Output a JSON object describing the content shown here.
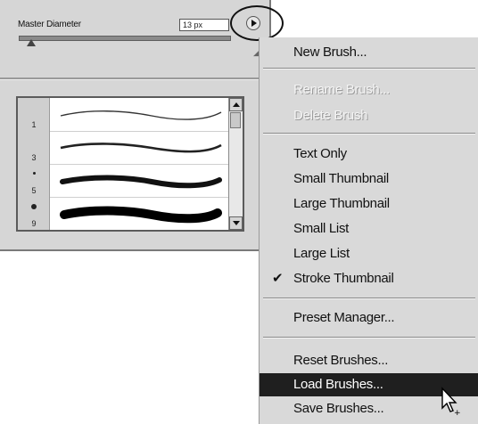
{
  "panel": {
    "master_diameter_label": "Master Diameter",
    "diameter_value": "13 px",
    "slider_value_percent": 4,
    "resize_glyph": "◢",
    "flyout_icon": "triangle-right-icon",
    "brushes": [
      {
        "number": "1",
        "stroke": "thin-wave"
      },
      {
        "number": "3",
        "stroke": "thin-wave"
      },
      {
        "number": "5",
        "stroke": "thick-wave"
      },
      {
        "number": "9",
        "stroke": "thicker-wave"
      }
    ]
  },
  "menu": {
    "items": [
      {
        "label": "New Brush...",
        "state": "enabled"
      },
      {
        "label": "Rename Brush...",
        "state": "disabled"
      },
      {
        "label": "Delete Brush",
        "state": "disabled"
      },
      {
        "label": "Text Only",
        "state": "enabled"
      },
      {
        "label": "Small Thumbnail",
        "state": "enabled"
      },
      {
        "label": "Large Thumbnail",
        "state": "enabled"
      },
      {
        "label": "Small List",
        "state": "enabled"
      },
      {
        "label": "Large List",
        "state": "enabled"
      },
      {
        "label": "Stroke Thumbnail",
        "state": "checked"
      },
      {
        "label": "Preset Manager...",
        "state": "enabled"
      },
      {
        "label": "Reset Brushes...",
        "state": "enabled"
      },
      {
        "label": "Load Brushes...",
        "state": "highlighted"
      },
      {
        "label": "Save Brushes...",
        "state": "enabled"
      }
    ],
    "check_glyph": "✔"
  },
  "colors": {
    "panel_bg": "#d6d6d6",
    "menu_bg": "#d9d9d9",
    "highlight_bg": "#1f1f1f",
    "highlight_text": "#ffffff"
  }
}
